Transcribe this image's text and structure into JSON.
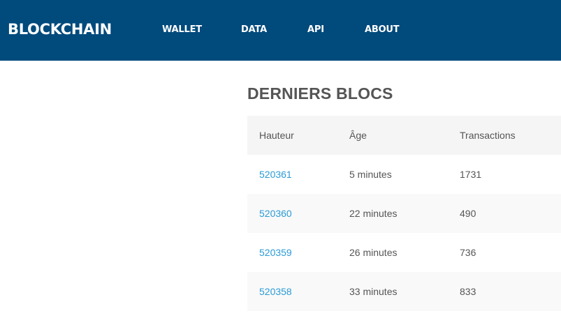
{
  "header": {
    "logo": "BLOCKCHAIN",
    "nav": [
      "WALLET",
      "DATA",
      "API",
      "ABOUT"
    ]
  },
  "latest_blocks": {
    "title": "DERNIERS BLOCS",
    "columns": [
      "Hauteur",
      "Âge",
      "Transactions"
    ],
    "rows": [
      {
        "height": "520361",
        "age": "5 minutes",
        "transactions": "1731"
      },
      {
        "height": "520360",
        "age": "22 minutes",
        "transactions": "490"
      },
      {
        "height": "520359",
        "age": "26 minutes",
        "transactions": "736"
      },
      {
        "height": "520358",
        "age": "33 minutes",
        "transactions": "833"
      }
    ]
  },
  "colors": {
    "header_bg": "#004a7c",
    "link": "#2a9bd6",
    "text": "#555555"
  }
}
